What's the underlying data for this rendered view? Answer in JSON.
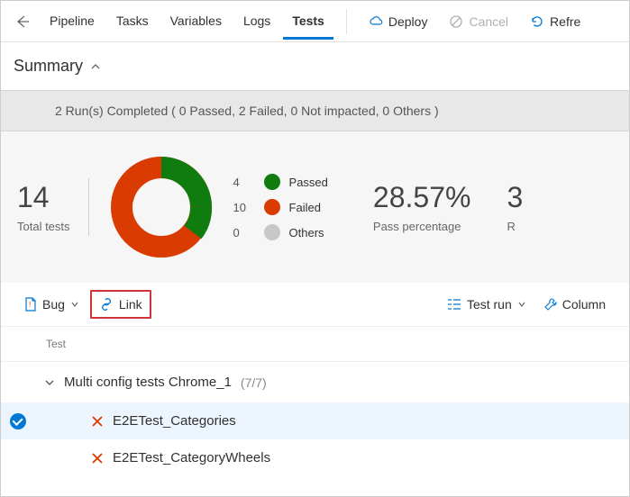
{
  "tabs": {
    "pipeline": "Pipeline",
    "tasks": "Tasks",
    "variables": "Variables",
    "logs": "Logs",
    "tests": "Tests"
  },
  "actions": {
    "deploy": "Deploy",
    "cancel": "Cancel",
    "refresh": "Refre"
  },
  "summary": {
    "title": "Summary"
  },
  "status_text": "2 Run(s) Completed ( 0 Passed, 2 Failed, 0 Not impacted, 0 Others )",
  "totals": {
    "count": "14",
    "label": "Total tests"
  },
  "legend": {
    "passed": {
      "n": "4",
      "label": "Passed"
    },
    "failed": {
      "n": "10",
      "label": "Failed"
    },
    "others": {
      "n": "0",
      "label": "Others"
    }
  },
  "pass_pct": {
    "value": "28.57%",
    "label": "Pass percentage"
  },
  "right_frag": {
    "value": "3",
    "label": "R"
  },
  "toolbar": {
    "bug": "Bug",
    "link": "Link",
    "testrun": "Test run",
    "column": "Column"
  },
  "table": {
    "col_test": "Test",
    "group_name": "Multi config tests Chrome_1",
    "group_count": "(7/7)",
    "row1": "E2ETest_Categories",
    "row2": "E2ETest_CategoryWheels"
  },
  "chart_data": {
    "type": "pie",
    "title": "",
    "categories": [
      "Passed",
      "Failed",
      "Others"
    ],
    "values": [
      4,
      10,
      0
    ],
    "colors": [
      "#107c10",
      "#da3b01",
      "#c8c8c8"
    ]
  }
}
